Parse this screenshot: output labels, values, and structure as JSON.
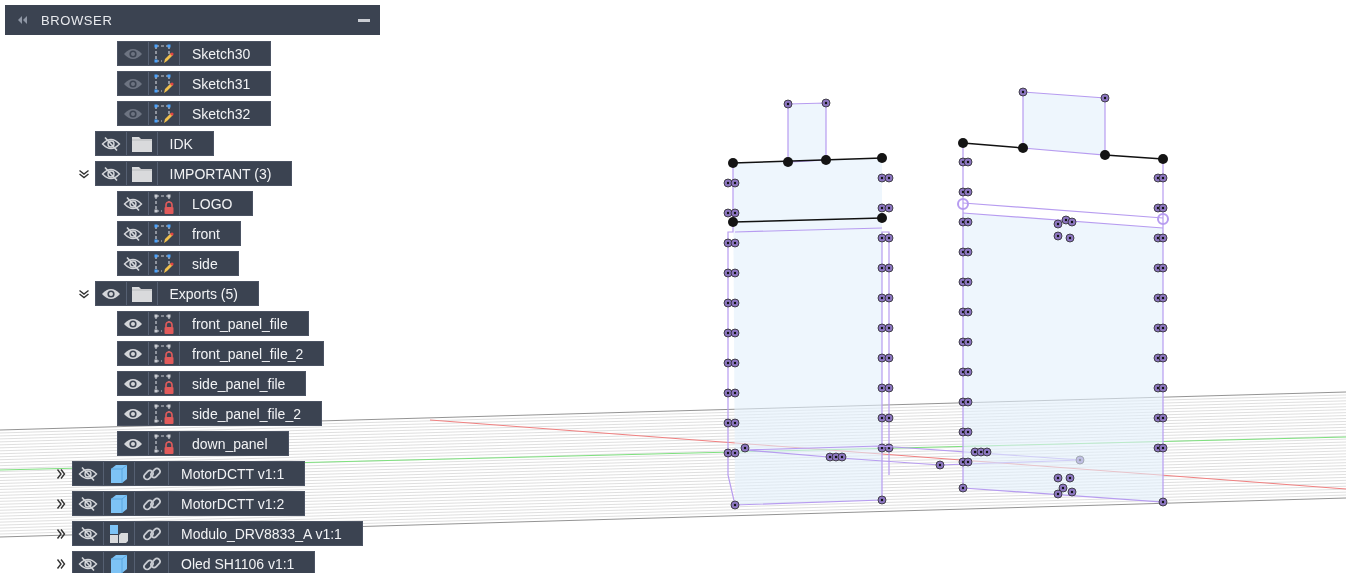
{
  "panel": {
    "title": "BROWSER",
    "tree": [
      {
        "children": [
          {
            "children": [
              {
                "kind": "sketch",
                "label": "Sketch30",
                "visible": true,
                "dimmed": true,
                "locked": false
              },
              {
                "kind": "sketch",
                "label": "Sketch31",
                "visible": true,
                "dimmed": true,
                "locked": false
              },
              {
                "kind": "sketch",
                "label": "Sketch32",
                "visible": true,
                "dimmed": true,
                "locked": false
              }
            ]
          },
          {
            "kind": "folder",
            "label": "IDK",
            "visible": false,
            "dimmed": false
          },
          {
            "kind": "folder",
            "label": "IMPORTANT (3)",
            "visible": false,
            "dimmed": false,
            "expanded": true,
            "children": [
              {
                "kind": "sketch",
                "label": "LOGO",
                "visible": false,
                "dimmed": false,
                "locked": true
              },
              {
                "kind": "sketch",
                "label": "front",
                "visible": false,
                "dimmed": false,
                "locked": false
              },
              {
                "kind": "sketch",
                "label": "side",
                "visible": false,
                "dimmed": false,
                "locked": false
              }
            ]
          },
          {
            "kind": "folder",
            "label": "Exports (5)",
            "visible": true,
            "dimmed": false,
            "expanded": true,
            "children": [
              {
                "kind": "sketch",
                "label": "front_panel_file",
                "visible": true,
                "dimmed": false,
                "locked": true
              },
              {
                "kind": "sketch",
                "label": "front_panel_file_2",
                "visible": true,
                "dimmed": false,
                "locked": true
              },
              {
                "kind": "sketch",
                "label": "side_panel_file",
                "visible": true,
                "dimmed": false,
                "locked": true
              },
              {
                "kind": "sketch",
                "label": "side_panel_file_2",
                "visible": true,
                "dimmed": false,
                "locked": true
              },
              {
                "kind": "sketch",
                "label": "down_panel",
                "visible": true,
                "dimmed": false,
                "locked": true
              }
            ]
          }
        ]
      },
      {
        "kind": "component",
        "label": "MotorDCTT v1:1",
        "visible": false,
        "dimmed": false,
        "expanded": false
      },
      {
        "kind": "component",
        "label": "MotorDCTT v1:2",
        "visible": false,
        "dimmed": false,
        "expanded": false
      },
      {
        "kind": "assembly",
        "label": "Modulo_DRV8833_A v1:1",
        "visible": false,
        "dimmed": false,
        "expanded": false
      },
      {
        "kind": "component",
        "label": "Oled SH1106 v1:1",
        "visible": false,
        "dimmed": false,
        "expanded": false
      }
    ]
  }
}
